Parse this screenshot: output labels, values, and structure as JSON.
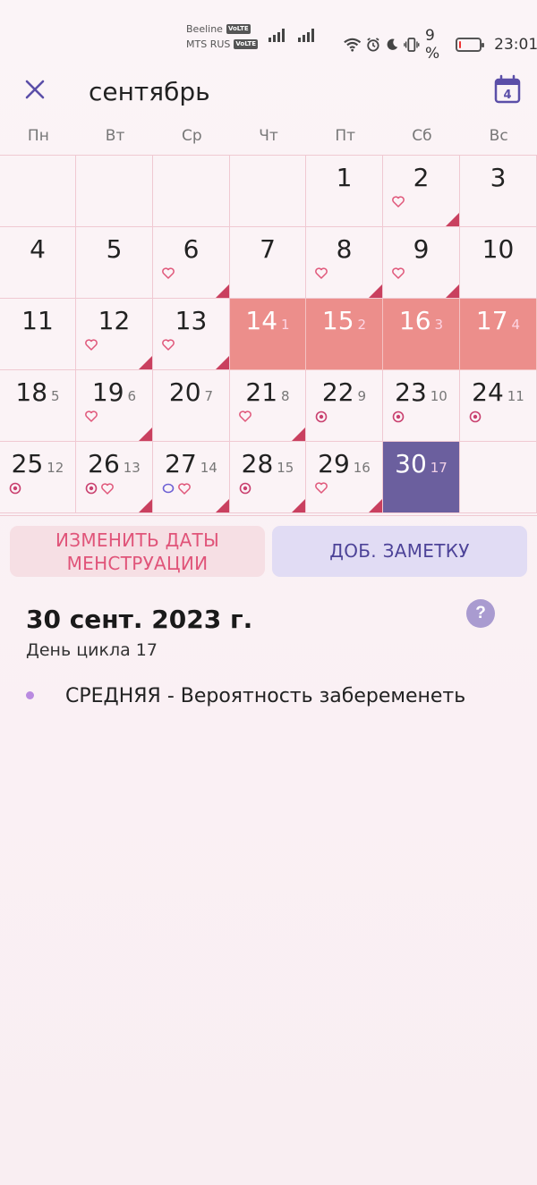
{
  "status_bar": {
    "carrier1": "Beeline",
    "carrier2": "MTS RUS",
    "volte": "VoLTE",
    "battery_percent": "9 %",
    "battery_level": 0.09,
    "time": "23:01"
  },
  "header": {
    "month": "сентябрь",
    "today_icon_day": "4"
  },
  "weekdays": [
    "Пн",
    "Вт",
    "Ср",
    "Чт",
    "Пт",
    "Сб",
    "Вс"
  ],
  "calendar": {
    "days": [
      {
        "day": "1",
        "cycle": "",
        "state": "normal",
        "icons": [],
        "corner": false
      },
      {
        "day": "2",
        "cycle": "",
        "state": "normal",
        "icons": [
          "heart"
        ],
        "corner": true
      },
      {
        "day": "3",
        "cycle": "",
        "state": "normal",
        "icons": [],
        "corner": false
      },
      {
        "day": "4",
        "cycle": "",
        "state": "normal",
        "icons": [],
        "corner": false
      },
      {
        "day": "5",
        "cycle": "",
        "state": "normal",
        "icons": [],
        "corner": false
      },
      {
        "day": "6",
        "cycle": "",
        "state": "normal",
        "icons": [
          "heart"
        ],
        "corner": true
      },
      {
        "day": "7",
        "cycle": "",
        "state": "normal",
        "icons": [],
        "corner": false
      },
      {
        "day": "8",
        "cycle": "",
        "state": "normal",
        "icons": [
          "heart"
        ],
        "corner": true
      },
      {
        "day": "9",
        "cycle": "",
        "state": "normal",
        "icons": [
          "heart"
        ],
        "corner": true
      },
      {
        "day": "10",
        "cycle": "",
        "state": "normal",
        "icons": [],
        "corner": false
      },
      {
        "day": "11",
        "cycle": "",
        "state": "normal",
        "icons": [],
        "corner": false
      },
      {
        "day": "12",
        "cycle": "",
        "state": "normal",
        "icons": [
          "heart"
        ],
        "corner": true
      },
      {
        "day": "13",
        "cycle": "",
        "state": "normal",
        "icons": [
          "heart"
        ],
        "corner": true
      },
      {
        "day": "14",
        "cycle": "1",
        "state": "period",
        "icons": [],
        "corner": false
      },
      {
        "day": "15",
        "cycle": "2",
        "state": "period",
        "icons": [],
        "corner": false
      },
      {
        "day": "16",
        "cycle": "3",
        "state": "period",
        "icons": [],
        "corner": false
      },
      {
        "day": "17",
        "cycle": "4",
        "state": "period",
        "icons": [],
        "corner": false
      },
      {
        "day": "18",
        "cycle": "5",
        "state": "normal",
        "icons": [],
        "corner": false
      },
      {
        "day": "19",
        "cycle": "6",
        "state": "normal",
        "icons": [
          "heart"
        ],
        "corner": true
      },
      {
        "day": "20",
        "cycle": "7",
        "state": "normal",
        "icons": [],
        "corner": false
      },
      {
        "day": "21",
        "cycle": "8",
        "state": "normal",
        "icons": [
          "heart"
        ],
        "corner": true
      },
      {
        "day": "22",
        "cycle": "9",
        "state": "normal",
        "icons": [
          "fertile"
        ],
        "corner": false
      },
      {
        "day": "23",
        "cycle": "10",
        "state": "normal",
        "icons": [
          "fertile"
        ],
        "corner": false
      },
      {
        "day": "24",
        "cycle": "11",
        "state": "normal",
        "icons": [
          "fertile"
        ],
        "corner": false
      },
      {
        "day": "25",
        "cycle": "12",
        "state": "normal",
        "icons": [
          "fertile"
        ],
        "corner": false
      },
      {
        "day": "26",
        "cycle": "13",
        "state": "normal",
        "icons": [
          "fertile",
          "heart"
        ],
        "corner": true
      },
      {
        "day": "27",
        "cycle": "14",
        "state": "normal",
        "icons": [
          "ovulation",
          "heart"
        ],
        "corner": true
      },
      {
        "day": "28",
        "cycle": "15",
        "state": "normal",
        "icons": [
          "fertile"
        ],
        "corner": true
      },
      {
        "day": "29",
        "cycle": "16",
        "state": "normal",
        "icons": [
          "heart"
        ],
        "corner": true
      },
      {
        "day": "30",
        "cycle": "17",
        "state": "selected",
        "icons": [],
        "corner": false
      }
    ]
  },
  "buttons": {
    "edit_period_line1": "ИЗМЕНИТЬ ДАТЫ",
    "edit_period_line2": "МЕНСТРУАЦИИ",
    "add_note": "ДОБ. ЗАМЕТКУ"
  },
  "details": {
    "date": "30 сент. 2023 г.",
    "cycle_day": "День цикла 17",
    "help": "?",
    "probability": "СРЕДНЯЯ - Вероятность забеременеть"
  },
  "colors": {
    "accent": "#5b4fa8",
    "period": "#ec8e8b",
    "selected": "#6b5f9e",
    "heart": "#e0577a",
    "corner": "#c9405f"
  }
}
